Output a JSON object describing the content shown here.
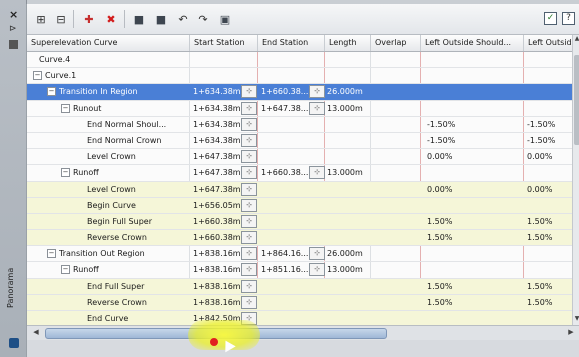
{
  "sidebar": {
    "label": "Panorama",
    "close": "×",
    "pin": "⊳"
  },
  "toolbar": {
    "buttons": [
      "expand-icon",
      "collapse-icon",
      "add-icon",
      "delete-icon",
      "view1-icon",
      "view2-icon",
      "undo-icon",
      "redo-icon",
      "export-icon"
    ],
    "check1": "✓",
    "check2": "?"
  },
  "columns": [
    "Superelevation Curve",
    "Start Station",
    "End Station",
    "Length",
    "Overlap",
    "Left Outside Should...",
    "Left Outside"
  ],
  "rows": [
    {
      "indent": 0,
      "toggle": "",
      "name": "Curve.4",
      "start": "",
      "end": "",
      "length": "",
      "lo": "",
      "lo2": "",
      "sel": false,
      "tint": false
    },
    {
      "indent": 0,
      "toggle": "−",
      "name": "Curve.1",
      "start": "",
      "end": "",
      "length": "",
      "lo": "",
      "lo2": "",
      "sel": false,
      "tint": false
    },
    {
      "indent": 1,
      "toggle": "−",
      "name": "Transition In Region",
      "start": "1+634.38m",
      "end": "1+660.38...",
      "length": "26.000m",
      "lo": "",
      "lo2": "",
      "sel": true,
      "tint": false
    },
    {
      "indent": 2,
      "toggle": "−",
      "name": "Runout",
      "start": "1+634.38m",
      "end": "1+647.38...",
      "length": "13.000m",
      "lo": "",
      "lo2": "",
      "sel": false,
      "tint": false
    },
    {
      "indent": 3,
      "toggle": "",
      "name": "End Normal Shoul...",
      "start": "1+634.38m",
      "end": "",
      "length": "",
      "lo": "-1.50%",
      "lo2": "-1.50%",
      "sel": false,
      "tint": false
    },
    {
      "indent": 3,
      "toggle": "",
      "name": "End Normal Crown",
      "start": "1+634.38m",
      "end": "",
      "length": "",
      "lo": "-1.50%",
      "lo2": "-1.50%",
      "sel": false,
      "tint": false
    },
    {
      "indent": 3,
      "toggle": "",
      "name": "Level Crown",
      "start": "1+647.38m",
      "end": "",
      "length": "",
      "lo": "0.00%",
      "lo2": "0.00%",
      "sel": false,
      "tint": false
    },
    {
      "indent": 2,
      "toggle": "−",
      "name": "Runoff",
      "start": "1+647.38m",
      "end": "1+660.38...",
      "length": "13.000m",
      "lo": "",
      "lo2": "",
      "sel": false,
      "tint": false
    },
    {
      "indent": 3,
      "toggle": "",
      "name": "Level Crown",
      "start": "1+647.38m",
      "end": "",
      "length": "",
      "lo": "0.00%",
      "lo2": "0.00%",
      "sel": false,
      "tint": true
    },
    {
      "indent": 3,
      "toggle": "",
      "name": "Begin Curve",
      "start": "1+656.05m",
      "end": "",
      "length": "",
      "lo": "",
      "lo2": "",
      "sel": false,
      "tint": true
    },
    {
      "indent": 3,
      "toggle": "",
      "name": "Begin Full Super",
      "start": "1+660.38m",
      "end": "",
      "length": "",
      "lo": "1.50%",
      "lo2": "1.50%",
      "sel": false,
      "tint": true
    },
    {
      "indent": 3,
      "toggle": "",
      "name": "Reverse Crown",
      "start": "1+660.38m",
      "end": "",
      "length": "",
      "lo": "1.50%",
      "lo2": "1.50%",
      "sel": false,
      "tint": true
    },
    {
      "indent": 1,
      "toggle": "−",
      "name": "Transition Out Region",
      "start": "1+838.16m",
      "end": "1+864.16...",
      "length": "26.000m",
      "lo": "",
      "lo2": "",
      "sel": false,
      "tint": false
    },
    {
      "indent": 2,
      "toggle": "−",
      "name": "Runoff",
      "start": "1+838.16m",
      "end": "1+851.16...",
      "length": "13.000m",
      "lo": "",
      "lo2": "",
      "sel": false,
      "tint": false
    },
    {
      "indent": 3,
      "toggle": "",
      "name": "End Full Super",
      "start": "1+838.16m",
      "end": "",
      "length": "",
      "lo": "1.50%",
      "lo2": "1.50%",
      "sel": false,
      "tint": true
    },
    {
      "indent": 3,
      "toggle": "",
      "name": "Reverse Crown",
      "start": "1+838.16m",
      "end": "",
      "length": "",
      "lo": "1.50%",
      "lo2": "1.50%",
      "sel": false,
      "tint": true
    },
    {
      "indent": 3,
      "toggle": "",
      "name": "End Curve",
      "start": "1+842.50m",
      "end": "",
      "length": "",
      "lo": "",
      "lo2": "",
      "sel": false,
      "tint": true
    }
  ],
  "colors": {
    "selected": "#4a7fd6",
    "tint": "#f5f6d8",
    "grid_line": "#e4b0b0",
    "delete": "#d21c1c"
  }
}
